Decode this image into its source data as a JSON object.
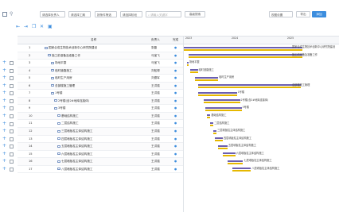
{
  "toolbar": {
    "filters": [
      "请选择负责人",
      "请选择工期",
      "按条件筛选",
      "请选择阶段"
    ],
    "search_placeholder": "请输入关键字",
    "search_button": "高级搜索",
    "zoom_select": "视图设置",
    "btn_export": "导出",
    "btn_primary": "添加"
  },
  "columns": {
    "name": "名称",
    "owner": "负责人",
    "flag": "完成"
  },
  "timeline_years": [
    "2023",
    "2024",
    "2025"
  ],
  "rows": [
    {
      "no": "1",
      "name": "国家合成生物技术创新中心研究院建设",
      "owner": "张磊",
      "flag": "●",
      "indent": 0
    },
    {
      "no": "2",
      "name": "施工前准备及准备工作",
      "owner": "马宝飞",
      "flag": "●",
      "indent": 1
    },
    {
      "no": "3",
      "name": "场地平整",
      "owner": "马宝飞",
      "flag": "●",
      "indent": 2
    },
    {
      "no": "4",
      "name": "临时道路施工",
      "owner": "刘松禄",
      "flag": "●",
      "indent": 2
    },
    {
      "no": "5",
      "name": "临时生产用房",
      "owner": "刘德军",
      "flag": "●",
      "indent": 2
    },
    {
      "no": "6",
      "name": "总部楼施工管理",
      "owner": "王洪强",
      "flag": "●",
      "indent": 2
    },
    {
      "no": "7",
      "name": "1号楼",
      "owner": "王洪强",
      "flag": "●",
      "indent": 2
    },
    {
      "no": "8",
      "name": "2号楼(含2#地库连接体)",
      "owner": "王洪强",
      "flag": "●",
      "indent": 3
    },
    {
      "no": "9",
      "name": "3号楼",
      "owner": "王洪强",
      "flag": "●",
      "indent": 3
    },
    {
      "no": "10",
      "name": "基础结构施工",
      "owner": "王洪强",
      "flag": "●",
      "indent": 4
    },
    {
      "no": "11",
      "name": "二层结构施工",
      "owner": "王洪强",
      "flag": "●",
      "indent": 4
    },
    {
      "no": "12",
      "name": "三层墙板柱主体结构施工",
      "owner": "王洪强",
      "flag": "●",
      "indent": 4
    },
    {
      "no": "13",
      "name": "四层墙板柱主体结构施工",
      "owner": "王洪强",
      "flag": "●",
      "indent": 4
    },
    {
      "no": "14",
      "name": "五层墙板柱主体结构施工",
      "owner": "王洪强",
      "flag": "●",
      "indent": 4
    },
    {
      "no": "15",
      "name": "六层墙板柱主体结构施工",
      "owner": "王洪强",
      "flag": "●",
      "indent": 4
    },
    {
      "no": "16",
      "name": "七层墙板柱主体结构施工",
      "owner": "王洪强",
      "flag": "●",
      "indent": 4
    },
    {
      "no": "17",
      "name": "八层墙板柱主体结构施工",
      "owner": "王洪强",
      "flag": "●",
      "indent": 4
    }
  ],
  "gantt_labels": [
    "国家合成生物技术创新中心研究院建设",
    "施工前准备及准备工作",
    "场地平整",
    "临时道路施工",
    "临时生产用房",
    "总部楼施工管理",
    "1号楼",
    "2号楼(含2#地库连接体)",
    "3号楼",
    "基础结构施工",
    "二层结构施工",
    "三层墙板柱主体结构施工",
    "四层墙板柱主体结构施工",
    "五层墙板柱主体结构施工",
    "六层墙板柱主体结构施工",
    "七层墙板柱主体结构施工",
    "八层墙板柱主体结构施工"
  ],
  "gantt_bars": [
    {
      "start": 0.0,
      "end": 0.76
    },
    {
      "start": 0.03,
      "end": 0.76
    },
    {
      "start": 0.02,
      "end": 0.03
    },
    {
      "start": 0.04,
      "end": 0.09
    },
    {
      "start": 0.07,
      "end": 0.22
    },
    {
      "start": 0.09,
      "end": 0.75
    },
    {
      "start": 0.09,
      "end": 0.34
    },
    {
      "start": 0.13,
      "end": 0.36
    },
    {
      "start": 0.14,
      "end": 0.37
    },
    {
      "start": 0.15,
      "end": 0.17
    },
    {
      "start": 0.17,
      "end": 0.19
    },
    {
      "start": 0.19,
      "end": 0.21
    },
    {
      "start": 0.2,
      "end": 0.25
    },
    {
      "start": 0.22,
      "end": 0.28
    },
    {
      "start": 0.25,
      "end": 0.33
    },
    {
      "start": 0.28,
      "end": 0.38
    },
    {
      "start": 0.31,
      "end": 0.43
    }
  ],
  "colors": {
    "accent": "#3c8dde",
    "bar_plan": "#6b5fb0",
    "bar_actual": "#e6b800"
  }
}
